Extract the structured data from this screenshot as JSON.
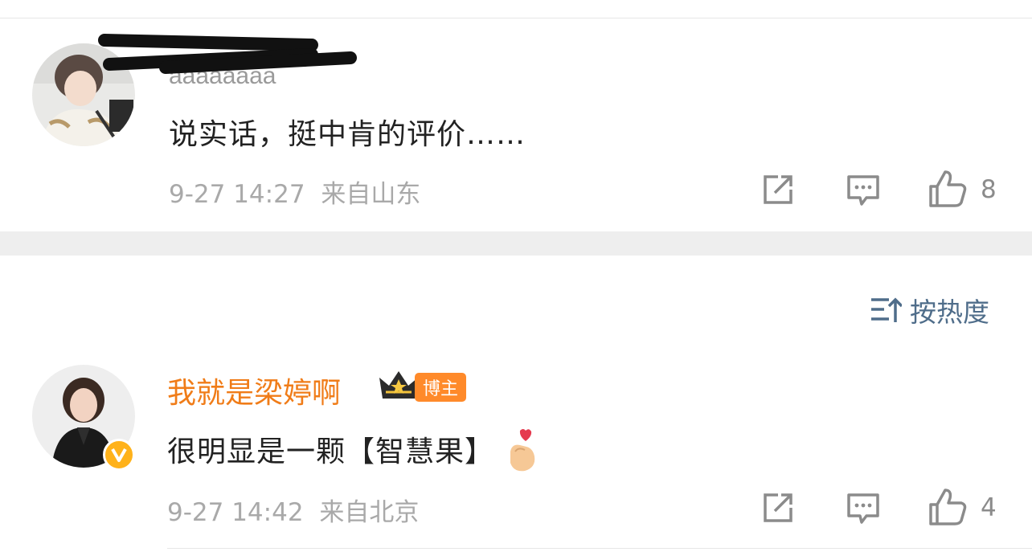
{
  "comments": [
    {
      "text": "说实话，挺中肯的评价……",
      "time": "9-27 14:27",
      "location": "来自山东",
      "likes": "8"
    },
    {
      "username": "我就是梁婷啊",
      "badge": "博主",
      "text": "很明显是一颗【智慧果】",
      "time": "9-27 14:42",
      "location": "来自北京",
      "likes": "4"
    }
  ],
  "sort_label": "按热度",
  "colors": {
    "username": "#f07c18",
    "meta_gray": "#a9a9a9",
    "sort_blue": "#4f6d8a",
    "badge_orange": "#ff8a2a"
  },
  "icons": [
    "share-icon",
    "comment-icon",
    "like-icon",
    "sort-icon",
    "crown-icon",
    "verified-v-icon",
    "finger-heart-emoji"
  ]
}
